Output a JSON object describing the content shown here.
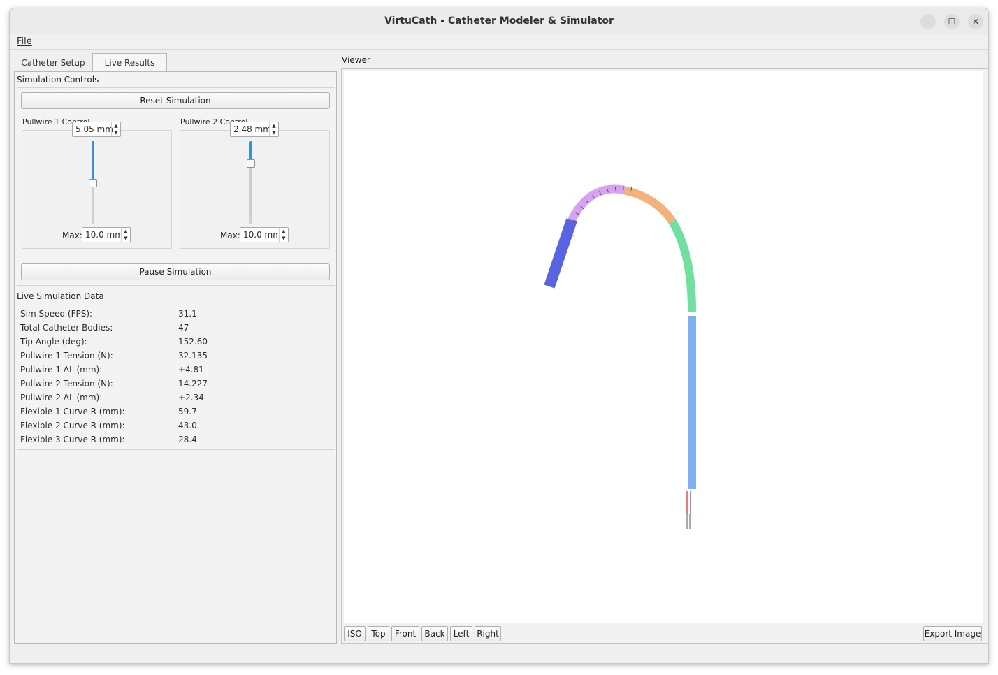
{
  "window": {
    "title": "VirtuCath - Catheter Modeler & Simulator",
    "minimize_icon": "–",
    "maximize_icon": "☐",
    "close_icon": "✕"
  },
  "menu": {
    "file": "File"
  },
  "tabs": [
    {
      "label": "Catheter Setup",
      "active": false
    },
    {
      "label": "Live Results",
      "active": true
    }
  ],
  "simulation_controls": {
    "title": "Simulation Controls",
    "reset_button": "Reset Simulation",
    "pause_button": "Pause Simulation",
    "pullwire1": {
      "label": "Pullwire 1 Control",
      "value": "5.05 mm",
      "max_label": "Max:",
      "max_value": "10.0 mm",
      "level": 0.505
    },
    "pullwire2": {
      "label": "Pullwire 2 Control",
      "value": "2.48 mm",
      "max_label": "Max:",
      "max_value": "10.0 mm",
      "level": 0.248
    }
  },
  "live_data": {
    "title": "Live Simulation Data",
    "rows": [
      {
        "label": "Sim Speed (FPS):",
        "value": "31.1"
      },
      {
        "label": "Total Catheter Bodies:",
        "value": "47"
      },
      {
        "label": "Tip Angle (deg):",
        "value": "152.60"
      },
      {
        "label": "Pullwire 1 Tension (N):",
        "value": "32.135"
      },
      {
        "label": "Pullwire 1 ΔL (mm):",
        "value": "+4.81"
      },
      {
        "label": "Pullwire 2 Tension (N):",
        "value": "14.227"
      },
      {
        "label": "Pullwire 2 ΔL (mm):",
        "value": "+2.34"
      },
      {
        "label": "Flexible 1 Curve R (mm):",
        "value": "59.7"
      },
      {
        "label": "Flexible 2 Curve R (mm):",
        "value": "43.0"
      },
      {
        "label": "Flexible 3 Curve R (mm):",
        "value": "28.4"
      }
    ]
  },
  "viewer": {
    "title": "Viewer",
    "buttons": [
      "ISO",
      "Top",
      "Front",
      "Back",
      "Left",
      "Right"
    ],
    "export_button": "Export Image",
    "colors": {
      "shaft": "#7fb0f0",
      "flex1": "#6fe0a0",
      "flex2": "#f3b27a",
      "flex3": "#d7a3f0",
      "tip": "#5a63e0",
      "pullwire": "#c0303a"
    }
  }
}
